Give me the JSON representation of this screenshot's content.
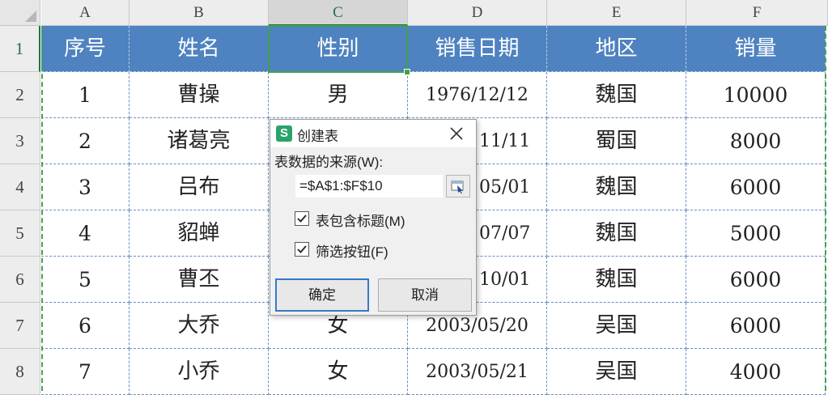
{
  "columns": [
    "A",
    "B",
    "C",
    "D",
    "E",
    "F"
  ],
  "rows": [
    "1",
    "2",
    "3",
    "4",
    "5",
    "6",
    "7",
    "8"
  ],
  "table": {
    "header": [
      "序号",
      "姓名",
      "性别",
      "销售日期",
      "地区",
      "销量"
    ],
    "data": [
      [
        "1",
        "曹操",
        "男",
        "1976/12/12",
        "魏国",
        "10000"
      ],
      [
        "2",
        "诸葛亮",
        "",
        "11/11",
        "蜀国",
        "8000"
      ],
      [
        "3",
        "吕布",
        "",
        "05/01",
        "魏国",
        "6000"
      ],
      [
        "4",
        "貂蝉",
        "",
        "07/07",
        "魏国",
        "5000"
      ],
      [
        "5",
        "曹丕",
        "",
        "10/01",
        "魏国",
        "6000"
      ],
      [
        "6",
        "大乔",
        "女",
        "2003/05/20",
        "吴国",
        "6000"
      ],
      [
        "7",
        "小乔",
        "女",
        "2003/05/21",
        "吴国",
        "4000"
      ]
    ]
  },
  "dialog": {
    "app_icon_letter": "S",
    "title": "创建表",
    "source_label": "表数据的来源(W):",
    "range_value": "=$A$1:$F$10",
    "checkbox_header": {
      "label": "表包含标题(M)",
      "checked": true
    },
    "checkbox_filter": {
      "label": "筛选按钮(F)",
      "checked": true
    },
    "ok_label": "确定",
    "cancel_label": "取消"
  },
  "colors": {
    "header_fill": "#4e82c0",
    "selection": "#3fa34d",
    "app_icon": "#2aa36b"
  }
}
